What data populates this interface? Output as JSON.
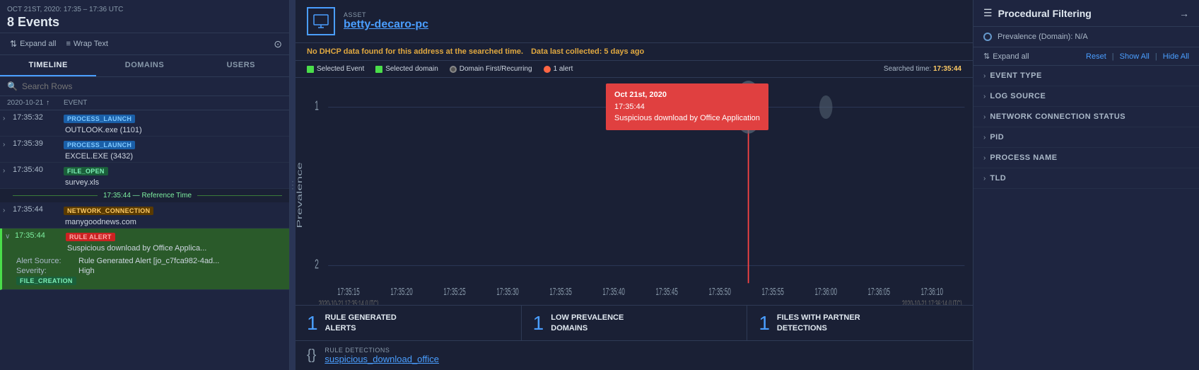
{
  "leftPanel": {
    "dateRange": "OCT 21ST, 2020: 17:35 – 17:36 UTC",
    "eventCount": "8 Events",
    "toolbar": {
      "expandAll": "Expand all",
      "wrapText": "Wrap Text"
    },
    "tabs": [
      {
        "label": "TIMELINE"
      },
      {
        "label": "DOMAINS"
      },
      {
        "label": "USERS"
      }
    ],
    "search": {
      "placeholder": "Search Rows"
    },
    "columns": {
      "date": "2020-10-21",
      "event": "EVENT"
    },
    "events": [
      {
        "time": "17:35:32",
        "tag": "PROCESS_LAUNCH",
        "tagType": "process",
        "name": "OUTLOOK.exe (1101)",
        "expanded": false
      },
      {
        "time": "17:35:39",
        "tag": "PROCESS_LAUNCH",
        "tagType": "process",
        "name": "EXCEL.EXE (3432)",
        "expanded": false
      },
      {
        "time": "17:35:40",
        "tag": "FILE_OPEN",
        "tagType": "file",
        "name": "survey.xls",
        "expanded": false
      },
      {
        "time": "17:35:44",
        "refTime": "Reference Time",
        "isRef": true
      },
      {
        "time": "17:35:44",
        "tag": "NETWORK_CONNECTION",
        "tagType": "network",
        "name": "manygoodnews.com",
        "expanded": false
      },
      {
        "time": "17:35:44",
        "tag": "RULE ALERT",
        "tagType": "rule",
        "name": "Suspicious download by Office Applica...",
        "selected": true,
        "expanded": true,
        "details": [
          {
            "label": "Alert Source:",
            "value": "Rule Generated Alert [jo_c7fca982-4ad..."
          },
          {
            "label": "Severity:",
            "value": "High"
          },
          {
            "tag": "FILE_CREATION",
            "tagType": "file-creation"
          }
        ]
      }
    ]
  },
  "middlePanel": {
    "asset": {
      "label": "ASSET",
      "name": "betty-decaro-pc"
    },
    "dhcp": {
      "message": "No DHCP data found for this address at the searched time.",
      "dataLastCollected": "Data last collected:",
      "daysAgo": "5 days ago"
    },
    "legend": {
      "items": [
        {
          "label": "Selected Event",
          "color": "#4ade4a",
          "shape": "square"
        },
        {
          "label": "Selected domain",
          "color": "#4ade4a",
          "shape": "square"
        },
        {
          "label": "Domain First/Recurring",
          "color": "#888",
          "shape": "circle"
        },
        {
          "label": "1 alert",
          "color": "#ff6644",
          "shape": "circle"
        }
      ],
      "searchedTime": "Searched time:",
      "searchedTimeValue": "17:35:44"
    },
    "chart": {
      "yLabel": "Prevalence",
      "yMin": 2,
      "yMax": 1,
      "xLabels": [
        "17:35:15",
        "17:35:20",
        "17:35:25",
        "17:35:30",
        "17:35:35",
        "17:35:40",
        "17:35:45",
        "17:35:50",
        "17:35:55",
        "17:36:00",
        "17:36:05",
        "17:36:10"
      ],
      "xSubLabels": [
        "2020-10-21 17:35:14 (UTC)",
        "2020-10-21 17:36:14 (UTC)"
      ]
    },
    "tooltip": {
      "line1": "Oct 21st, 2020",
      "line2": "17:35:44",
      "line3": "Suspicious download by Office Application"
    },
    "stats": [
      {
        "number": "1",
        "label": "RULE GENERATED\nALERTS"
      },
      {
        "number": "1",
        "label": "LOW PREVALENCE\nDOMAINS"
      },
      {
        "number": "1",
        "label": "FILES WITH PARTNER\nDETECTIONS"
      }
    ],
    "ruleDetections": {
      "label": "RULE DETECTIONS",
      "name": "suspicious_download_office"
    }
  },
  "rightPanel": {
    "title": "Procedural Filtering",
    "prevalence": "Prevalence (Domain): N/A",
    "toolbar": {
      "expandAll": "Expand all",
      "reset": "Reset",
      "showAll": "Show All",
      "hideAll": "Hide All"
    },
    "sections": [
      {
        "label": "EVENT TYPE"
      },
      {
        "label": "LOG SOURCE"
      },
      {
        "label": "NETWORK CONNECTION STATUS"
      },
      {
        "label": "PID"
      },
      {
        "label": "PROCESS NAME"
      },
      {
        "label": "TLD"
      }
    ]
  }
}
